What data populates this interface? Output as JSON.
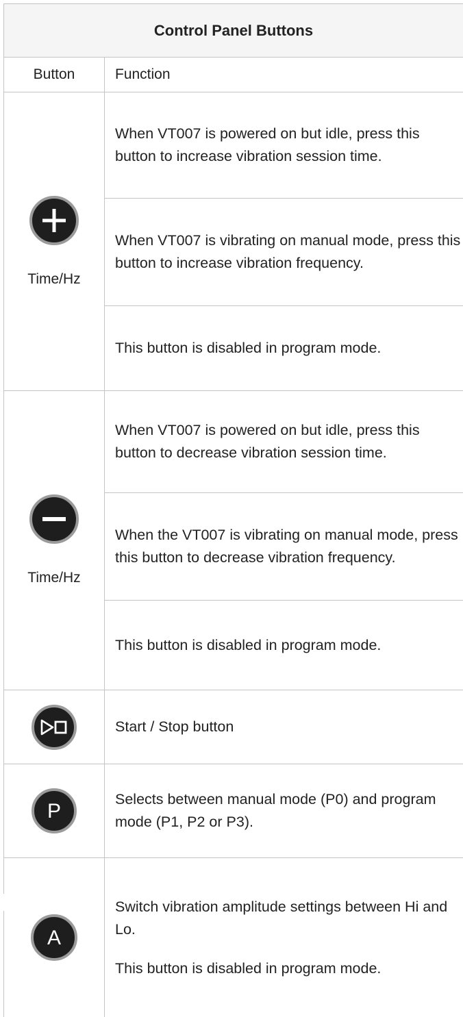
{
  "table": {
    "title": "Control Panel Buttons",
    "header": {
      "button": "Button",
      "function": "Function"
    },
    "rows": [
      {
        "icon": "plus-icon",
        "label": "Time/Hz",
        "functions": [
          "When VT007 is powered on but idle, press this button to increase vibration session time.",
          "When VT007 is vibrating on manual mode, press this button to increase vibration frequency.",
          "This button is disabled in program mode."
        ]
      },
      {
        "icon": "minus-icon",
        "label": "Time/Hz",
        "functions": [
          "When VT007 is powered on but idle, press this button to decrease vibration session time.",
          "When the VT007 is vibrating on manual mode, press this button to decrease vibration frequency.",
          "This button is disabled in program mode."
        ]
      },
      {
        "icon": "play-stop-icon",
        "functions": [
          "Start / Stop button"
        ]
      },
      {
        "icon": "p-letter-icon",
        "letter": "P",
        "functions": [
          "Selects between manual mode (P0) and program mode (P1, P2 or P3)."
        ]
      },
      {
        "icon": "a-letter-icon",
        "letter": "A",
        "functions": [
          "Switch vibration amplitude settings between Hi and Lo.",
          "This button is disabled in program mode."
        ]
      }
    ]
  },
  "colors": {
    "border": "#c4c4c4",
    "title_background": "#f5f5f5",
    "icon_fill": "#1e1e1e",
    "icon_ring": "#9b9b9b",
    "text": "#222222"
  }
}
